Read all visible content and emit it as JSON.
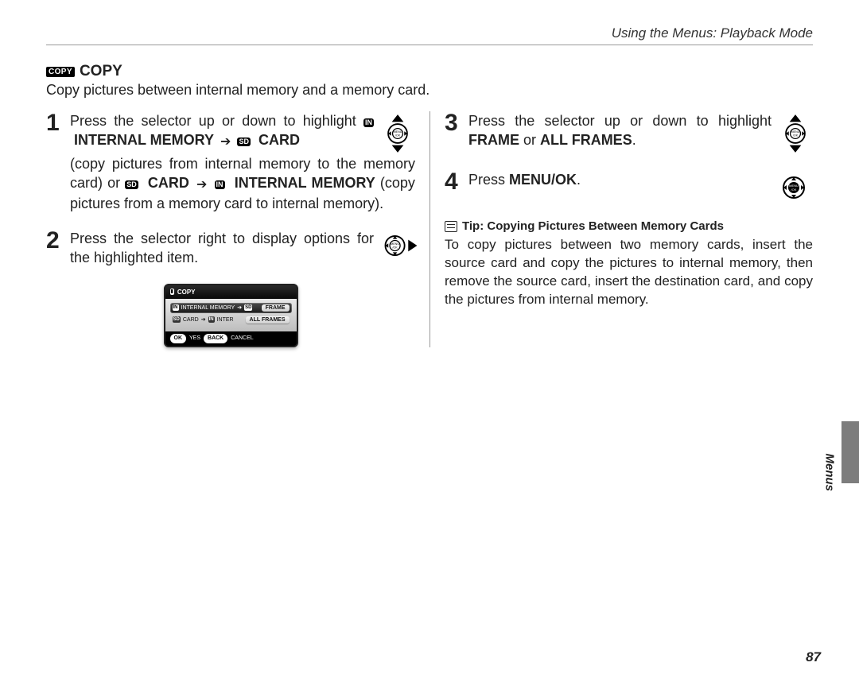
{
  "header": {
    "breadcrumb": "Using the Menus: Playback Mode"
  },
  "heading": {
    "badge": "COPY",
    "title": "COPY"
  },
  "intro": "Copy pictures between internal memory and a memory card.",
  "chips": {
    "in": "IN",
    "sd": "SD"
  },
  "labels": {
    "internal_memory": "INTERNAL MEMORY",
    "card": "CARD",
    "frame": "FRAME",
    "all_frames": "ALL FRAMES",
    "menu_ok": "MENU/OK"
  },
  "steps": {
    "s1": {
      "num": "1",
      "t1": "Press the selector up or down to highlight ",
      "t2": " (copy pictures from internal memory to the memory card) or ",
      "t3": " (copy pictures from a memory card to internal memory)."
    },
    "s2": {
      "num": "2",
      "text": "Press the selector right to display options for the highlighted item."
    },
    "s3": {
      "num": "3",
      "t1": "Press the selector up or down to highlight ",
      "t2": " or ",
      "t3": "."
    },
    "s4": {
      "num": "4",
      "t1": "Press ",
      "t2": "."
    }
  },
  "mock": {
    "title": "COPY",
    "row1": "INTERNAL MEMORY",
    "row1_dest": "CARD",
    "row2": "CARD",
    "row2_dest": "INTER",
    "opt_frame": "FRAME",
    "opt_all": "ALL FRAMES",
    "ok": "OK",
    "yes": "YES",
    "back": "BACK",
    "cancel": "CANCEL"
  },
  "tip": {
    "title": "Tip: Copying Pictures Between Memory Cards",
    "body": "To copy pictures between two memory cards, insert the source card and copy the pictures to internal memory, then remove the source card, insert the destination card, and copy the pictures from internal memory."
  },
  "side": {
    "label": "Menus"
  },
  "page": {
    "number": "87"
  }
}
